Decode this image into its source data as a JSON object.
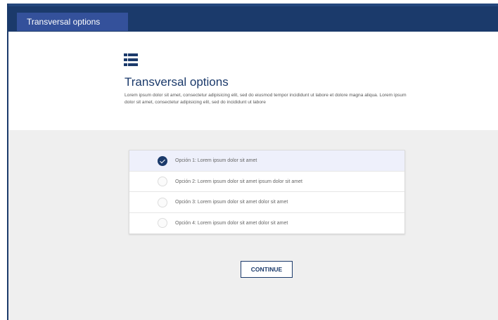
{
  "header": {
    "active_tab": "Transversal options"
  },
  "intro": {
    "icon": "list-icon",
    "title": "Transversal options",
    "description": "Lorem ipsum dolor sit amet, consectetur adipisicing elit, sed do eiusmod tempor incididunt ut labore et dolore magna aliqua. Lorem ipsum dolor sit amet, consectetur adipisicing elit, sed do incididunt ut labore"
  },
  "options": [
    {
      "label": "Opción 1: Lorem ipsum dolor sit amet",
      "selected": true
    },
    {
      "label": "Opción 2: Lorem ipsum dolor sit amet ipsum dolor sit amet",
      "selected": false
    },
    {
      "label": "Opción 3: Lorem ipsum dolor sit amet dolor sit amet",
      "selected": false
    },
    {
      "label": "Opción 4: Lorem ipsum dolor sit amet dolor sit amet",
      "selected": false
    }
  ],
  "actions": {
    "continue_label": "CONTINUE"
  },
  "colors": {
    "primary": "#1b3a6b",
    "tab_active": "#34519b",
    "selected_row": "#eef0fb",
    "background": "#efefef"
  }
}
